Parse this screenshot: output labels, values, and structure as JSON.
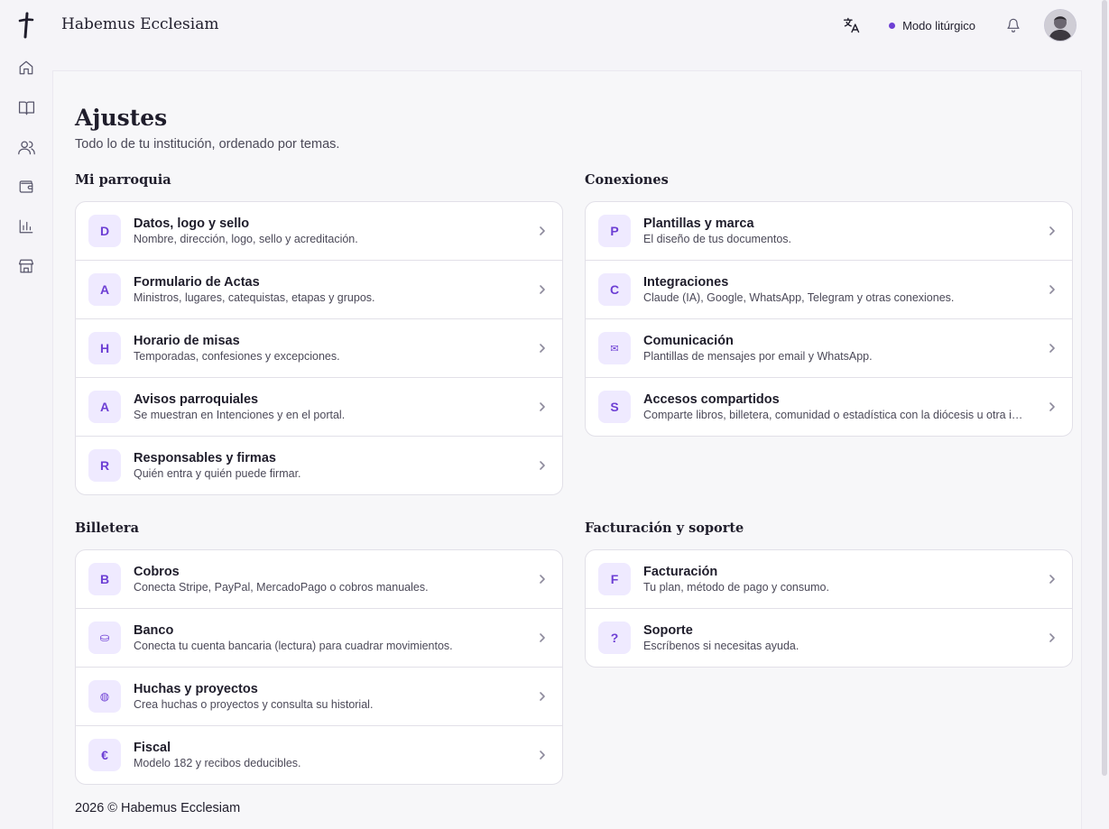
{
  "header": {
    "brand": "Habemus Ecclesiam",
    "liturgy_mode_label": "Modo litúrgico"
  },
  "page": {
    "title": "Ajustes",
    "subtitle": "Todo lo de tu institución, ordenado por temas."
  },
  "sections": {
    "parroquia": {
      "title": "Mi parroquia",
      "items": [
        {
          "badge": "D",
          "title": "Datos, logo y sello",
          "desc": "Nombre, dirección, logo, sello y acreditación."
        },
        {
          "badge": "A",
          "title": "Formulario de Actas",
          "desc": "Ministros, lugares, catequistas, etapas y grupos."
        },
        {
          "badge": "H",
          "title": "Horario de misas",
          "desc": "Temporadas, confesiones y excepciones."
        },
        {
          "badge": "A",
          "title": "Avisos parroquiales",
          "desc": "Se muestran en Intenciones y en el portal."
        },
        {
          "badge": "R",
          "title": "Responsables y firmas",
          "desc": "Quién entra y quién puede firmar."
        }
      ]
    },
    "conexiones": {
      "title": "Conexiones",
      "items": [
        {
          "badge": "P",
          "title": "Plantillas y marca",
          "desc": "El diseño de tus documentos."
        },
        {
          "badge": "C",
          "title": "Integraciones",
          "desc": "Claude (IA), Google, WhatsApp, Telegram y otras conexiones."
        },
        {
          "badge": "✉",
          "title": "Comunicación",
          "desc": "Plantillas de mensajes por email y WhatsApp."
        },
        {
          "badge": "S",
          "title": "Accesos compartidos",
          "desc": "Comparte libros, billetera, comunidad o estadística con la diócesis u otra institución."
        }
      ]
    },
    "billetera": {
      "title": "Billetera",
      "items": [
        {
          "badge": "B",
          "title": "Cobros",
          "desc": "Conecta Stripe, PayPal, MercadoPago o cobros manuales."
        },
        {
          "badge": "⛀",
          "title": "Banco",
          "desc": "Conecta tu cuenta bancaria (lectura) para cuadrar movimientos."
        },
        {
          "badge": "◍",
          "title": "Huchas y proyectos",
          "desc": "Crea huchas o proyectos y consulta su historial."
        },
        {
          "badge": "€",
          "title": "Fiscal",
          "desc": "Modelo 182 y recibos deducibles."
        }
      ]
    },
    "facturacion": {
      "title": "Facturación y soporte",
      "items": [
        {
          "badge": "F",
          "title": "Facturación",
          "desc": "Tu plan, método de pago y consumo."
        },
        {
          "badge": "?",
          "title": "Soporte",
          "desc": "Escríbenos si necesitas ayuda."
        }
      ]
    }
  },
  "footer": {
    "text": "2026 ©  Habemus Ecclesiam"
  },
  "colors": {
    "accent": "#6d3fd4",
    "badge_bg": "#efeaff",
    "page_bg": "#f5f4f8"
  },
  "icons": {
    "rail": [
      "cross-logo-icon",
      "home-icon",
      "book-icon",
      "users-icon",
      "wallet-icon",
      "chart-icon",
      "store-icon"
    ],
    "header": [
      "translate-icon",
      "bell-icon",
      "avatar"
    ]
  }
}
